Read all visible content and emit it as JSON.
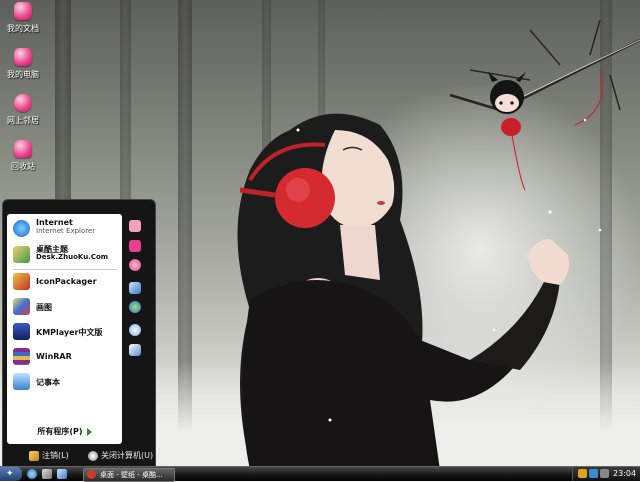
{
  "desktop": {
    "icons": [
      {
        "label": "我的文档",
        "icon": "my-documents-icon"
      },
      {
        "label": "我的电脑",
        "icon": "my-computer-icon"
      },
      {
        "label": "网上邻居",
        "icon": "network-places-icon"
      },
      {
        "label": "回收站",
        "icon": "recycle-bin-icon"
      }
    ]
  },
  "start_menu": {
    "programs": [
      {
        "name": "Internet",
        "sub": "Internet Explorer",
        "icon": "internet-explorer-icon"
      },
      {
        "name": "桌酷主题",
        "sub": "Desk.ZhuoKu.Com",
        "icon": "zhuoku-theme-icon"
      },
      {
        "name": "IconPackager",
        "icon": "iconpackager-icon"
      },
      {
        "name": "画图",
        "icon": "paint-icon"
      },
      {
        "name": "KMPlayer中文版",
        "icon": "kmplayer-icon"
      },
      {
        "name": "WinRAR",
        "icon": "winrar-icon"
      },
      {
        "name": "记事本",
        "icon": "notepad-icon"
      }
    ],
    "all_programs": "所有程序(P)",
    "logoff": "注销(L)",
    "shutdown": "关闭计算机(U)"
  },
  "taskbar": {
    "task": "桌面 - 壁纸 - 桌酷...",
    "clock": "23:04"
  },
  "colors": {
    "accent_pink": "#e8408a",
    "headphone_red": "#d42a30",
    "taskbar": "#1b1b1b"
  }
}
